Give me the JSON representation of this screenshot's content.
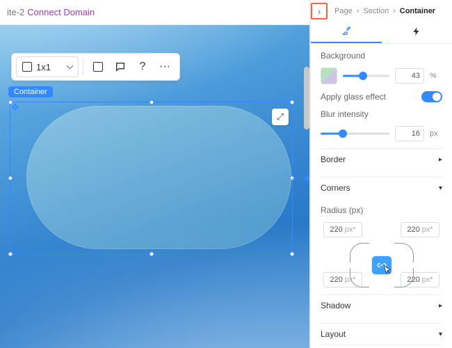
{
  "topbar": {
    "site_suffix": "ite-2",
    "connect": "Connect Domain"
  },
  "float_toolbar": {
    "grid_label": "1x1",
    "help_label": "?",
    "more_label": "···"
  },
  "selection": {
    "label": "Container"
  },
  "collapse_glyph": "›",
  "breadcrumbs": {
    "a": "Page",
    "b": "Section",
    "c": "Container",
    "sep": "›"
  },
  "tabs": {
    "design_icon": "✎",
    "actions_icon": "⚡"
  },
  "panel": {
    "background_label": "Background",
    "bg_opacity": "43",
    "bg_unit": "%",
    "glass_label": "Apply glass effect",
    "glass_on": true,
    "blur_label": "Blur intensity",
    "blur_value": "16",
    "blur_unit": "px",
    "border_label": "Border",
    "corners_label": "Corners",
    "radius_label": "Radius (px)",
    "radius": {
      "tl": "220",
      "tr": "220",
      "bl": "220",
      "br": "220",
      "unit": "px*"
    },
    "shadow_label": "Shadow",
    "layout_label": "Layout"
  },
  "slider_positions": {
    "bg_pct": 43,
    "blur_pct": 32
  }
}
